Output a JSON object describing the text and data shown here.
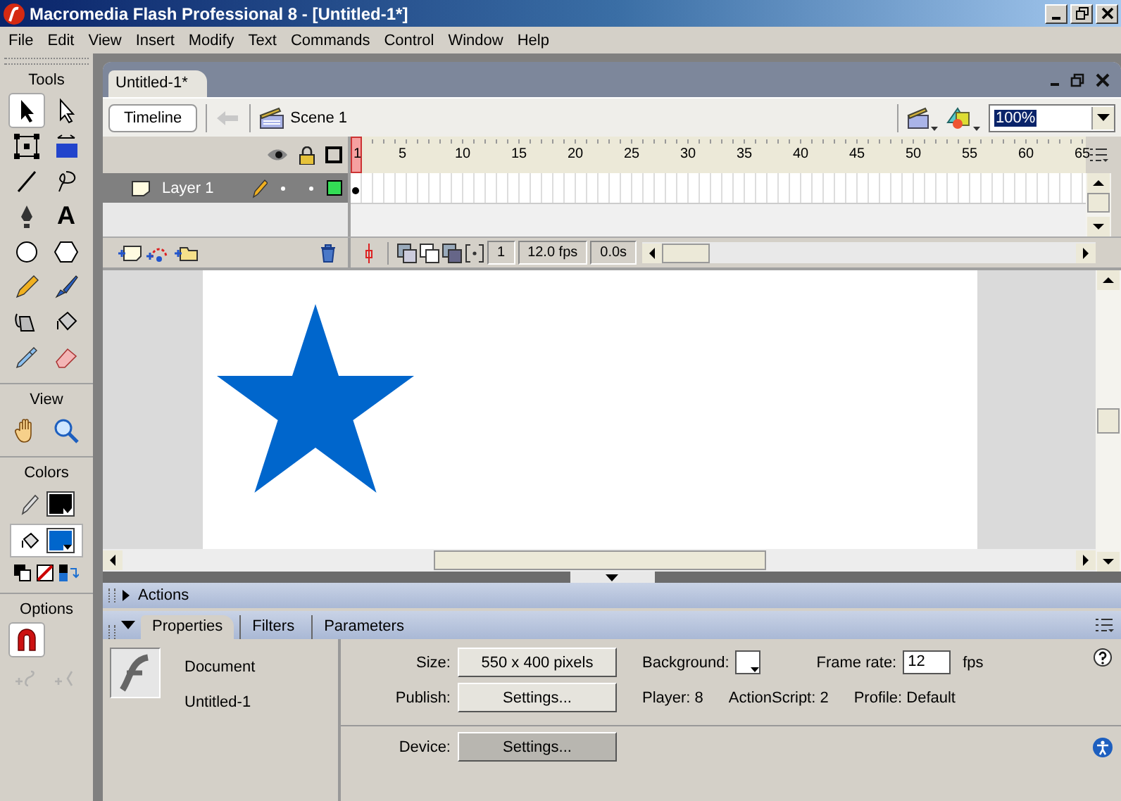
{
  "window": {
    "title": "Macromedia Flash Professional 8 - [Untitled-1*]"
  },
  "menu": [
    "File",
    "Edit",
    "View",
    "Insert",
    "Modify",
    "Text",
    "Commands",
    "Control",
    "Window",
    "Help"
  ],
  "tools_panel": {
    "title": "Tools",
    "tools": [
      {
        "kind": "arrow",
        "selected": true
      },
      {
        "kind": "subselect",
        "selected": false
      },
      {
        "kind": "free-transform",
        "selected": false
      },
      {
        "kind": "gradient-transform",
        "selected": false
      },
      {
        "kind": "line",
        "selected": false
      },
      {
        "kind": "lasso",
        "selected": false
      },
      {
        "kind": "pen",
        "selected": false
      },
      {
        "kind": "text",
        "glyph": "A",
        "selected": false
      },
      {
        "kind": "oval",
        "selected": false
      },
      {
        "kind": "polystar",
        "selected": false
      },
      {
        "kind": "pencil",
        "selected": false
      },
      {
        "kind": "brush",
        "selected": false
      },
      {
        "kind": "ink-bottle",
        "selected": false
      },
      {
        "kind": "paint-bucket",
        "selected": false
      },
      {
        "kind": "eyedropper",
        "selected": false
      },
      {
        "kind": "eraser",
        "selected": false
      }
    ],
    "view_title": "View",
    "view_tools": [
      {
        "kind": "hand",
        "selected": false
      },
      {
        "kind": "zoom",
        "selected": false
      }
    ],
    "colors_title": "Colors",
    "colors": [
      {
        "kind": "stroke",
        "color": "#000000",
        "selected": false
      },
      {
        "kind": "fill",
        "color": "#0066cc",
        "selected": true
      }
    ],
    "options_title": "Options",
    "options": [
      {
        "kind": "snap",
        "selected": true,
        "disabled": false
      },
      {
        "kind": "smooth",
        "selected": false,
        "disabled": true
      },
      {
        "kind": "straighten",
        "selected": false,
        "disabled": true
      }
    ]
  },
  "document": {
    "tab": "Untitled-1*",
    "timeline_button": "Timeline",
    "scene": "Scene 1",
    "zoom": "100%"
  },
  "timeline": {
    "ruler": [
      "1",
      "5",
      "10",
      "15",
      "20",
      "25",
      "30",
      "35",
      "40",
      "45",
      "50",
      "55",
      "60",
      "65"
    ],
    "layers": [
      {
        "name": "Layer 1",
        "selected": true,
        "color": "#33dd55"
      }
    ],
    "current_frame": "1",
    "frame_rate": "12.0 fps",
    "elapsed": "0.0s"
  },
  "stage": {
    "shapes": [
      {
        "kind": "star",
        "color": "#0066cc"
      }
    ]
  },
  "actions_panel": {
    "title": "Actions",
    "expanded": false
  },
  "properties_panel": {
    "expanded": true,
    "tabs": [
      {
        "label": "Properties",
        "selected": true
      },
      {
        "label": "Filters",
        "selected": false
      },
      {
        "label": "Parameters",
        "selected": false
      }
    ],
    "type": "Document",
    "name": "Untitled-1",
    "size_label": "Size:",
    "size": "550 x 400 pixels",
    "background_label": "Background:",
    "frame_rate_label": "Frame rate:",
    "frame_rate": "12",
    "fps": "fps",
    "publish_label": "Publish:",
    "publish_button": "Settings...",
    "player": "Player: 8",
    "actionscript": "ActionScript: 2",
    "profile": "Profile: Default",
    "device_label": "Device:",
    "device_button": "Settings..."
  }
}
